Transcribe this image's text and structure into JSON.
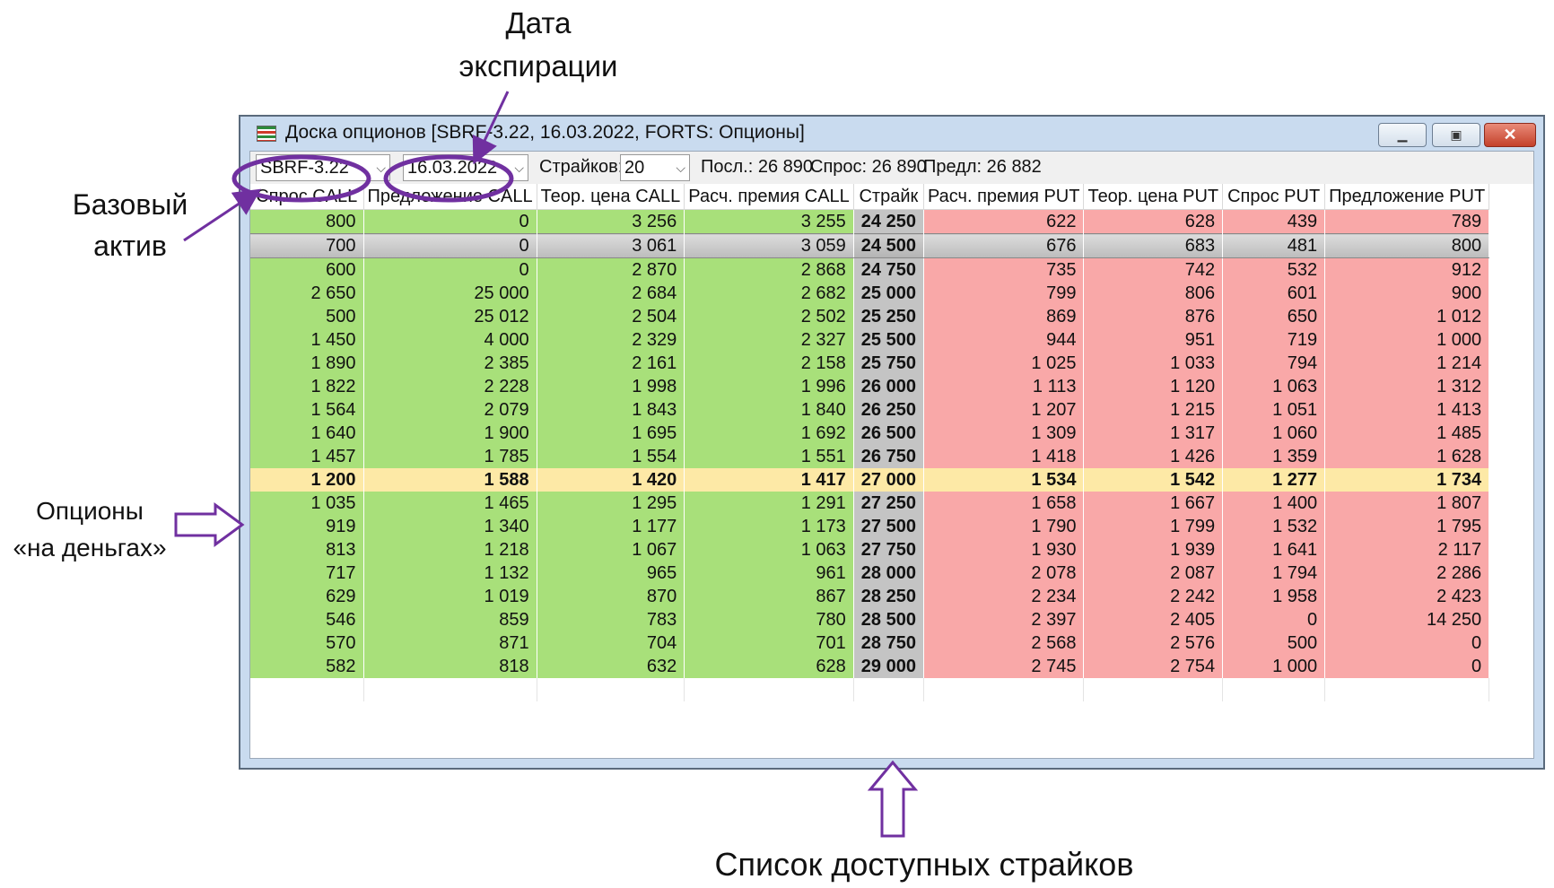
{
  "annotations": {
    "date_line1": "Дата",
    "date_line2": "экспирации",
    "base_line1": "Базовый",
    "base_line2": "актив",
    "atm_line1": "Опционы",
    "atm_line2": "«на деньгах»",
    "strikes_list": "Список доступных страйков",
    "accent_color": "#7030a0"
  },
  "window": {
    "title": "Доска опционов [SBRF-3.22, 16.03.2022, FORTS: Опционы]",
    "icon": "options-board-icon",
    "minimize_icon": "minimize-icon",
    "maximize_icon": "maximize-icon",
    "close_icon": "close-icon"
  },
  "toolbar": {
    "asset": "SBRF-3.22",
    "expiry": "16.03.2022",
    "strikes_label": "Страйков:",
    "strikes_count": "20",
    "last": "Посл.: 26 890",
    "bid": "Спрос: 26 890",
    "ask": "Предл: 26 882"
  },
  "table": {
    "columns": [
      "Спрос CALL",
      "Предложение CALL",
      "Теор. цена CALL",
      "Расч. премия CALL",
      "Страйк",
      "Расч. премия PUT",
      "Теор. цена PUT",
      "Спрос PUT",
      "Предложение PUT"
    ],
    "colors": {
      "call": "#a8e07a",
      "put": "#f9a8a8",
      "strike": "#c4c4c4",
      "atm": "#fde9a6"
    },
    "rows": [
      [
        "800",
        "0",
        "3 256",
        "3 255",
        "24 250",
        "622",
        "628",
        "439",
        "789"
      ],
      [
        "700",
        "0",
        "3 061",
        "3 059",
        "24 500",
        "676",
        "683",
        "481",
        "800"
      ],
      [
        "600",
        "0",
        "2 870",
        "2 868",
        "24 750",
        "735",
        "742",
        "532",
        "912"
      ],
      [
        "2 650",
        "25 000",
        "2 684",
        "2 682",
        "25 000",
        "799",
        "806",
        "601",
        "900"
      ],
      [
        "500",
        "25 012",
        "2 504",
        "2 502",
        "25 250",
        "869",
        "876",
        "650",
        "1 012"
      ],
      [
        "1 450",
        "4 000",
        "2 329",
        "2 327",
        "25 500",
        "944",
        "951",
        "719",
        "1 000"
      ],
      [
        "1 890",
        "2 385",
        "2 161",
        "2 158",
        "25 750",
        "1 025",
        "1 033",
        "794",
        "1 214"
      ],
      [
        "1 822",
        "2 228",
        "1 998",
        "1 996",
        "26 000",
        "1 113",
        "1 120",
        "1 063",
        "1 312"
      ],
      [
        "1 564",
        "2 079",
        "1 843",
        "1 840",
        "26 250",
        "1 207",
        "1 215",
        "1 051",
        "1 413"
      ],
      [
        "1 640",
        "1 900",
        "1 695",
        "1 692",
        "26 500",
        "1 309",
        "1 317",
        "1 060",
        "1 485"
      ],
      [
        "1 457",
        "1 785",
        "1 554",
        "1 551",
        "26 750",
        "1 418",
        "1 426",
        "1 359",
        "1 628"
      ],
      [
        "1 200",
        "1 588",
        "1 420",
        "1 417",
        "27 000",
        "1 534",
        "1 542",
        "1 277",
        "1 734"
      ],
      [
        "1 035",
        "1 465",
        "1 295",
        "1 291",
        "27 250",
        "1 658",
        "1 667",
        "1 400",
        "1 807"
      ],
      [
        "919",
        "1 340",
        "1 177",
        "1 173",
        "27 500",
        "1 790",
        "1 799",
        "1 532",
        "1 795"
      ],
      [
        "813",
        "1 218",
        "1 067",
        "1 063",
        "27 750",
        "1 930",
        "1 939",
        "1 641",
        "2 117"
      ],
      [
        "717",
        "1 132",
        "965",
        "961",
        "28 000",
        "2 078",
        "2 087",
        "1 794",
        "2 286"
      ],
      [
        "629",
        "1 019",
        "870",
        "867",
        "28 250",
        "2 234",
        "2 242",
        "1 958",
        "2 423"
      ],
      [
        "546",
        "859",
        "783",
        "780",
        "28 500",
        "2 397",
        "2 405",
        "0",
        "14 250"
      ],
      [
        "570",
        "871",
        "704",
        "701",
        "28 750",
        "2 568",
        "2 576",
        "500",
        "0"
      ],
      [
        "582",
        "818",
        "632",
        "628",
        "29 000",
        "2 745",
        "2 754",
        "1 000",
        "0"
      ]
    ],
    "selected_row": 1,
    "atm_row": 11
  }
}
